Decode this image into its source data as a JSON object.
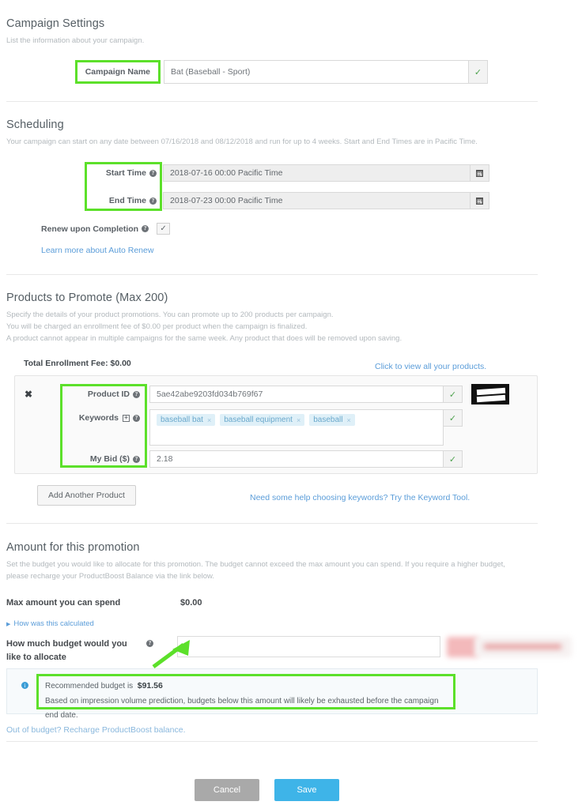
{
  "campaign_settings": {
    "title": "Campaign Settings",
    "subtitle": "List the information about your campaign.",
    "name_label": "Campaign Name",
    "name_value": "Bat (Baseball - Sport)",
    "valid_icon": "check-icon"
  },
  "scheduling": {
    "title": "Scheduling",
    "subtitle": "Your campaign can start on any date between 07/16/2018 and 08/12/2018 and run for up to 4 weeks. Start and End Times are in Pacific Time.",
    "start_label": "Start Time",
    "start_value": "2018-07-16 00:00 Pacific Time",
    "end_label": "End Time",
    "end_value": "2018-07-23 00:00 Pacific Time",
    "renew_label": "Renew upon Completion",
    "renew_checked": "✓",
    "auto_renew_link": "Learn more about Auto Renew",
    "calendar_icon": "calendar-icon"
  },
  "products": {
    "title": "Products to Promote (Max 200)",
    "subtitle_line1": "Specify the details of your product promotions. You can promote up to 200 products per campaign.",
    "subtitle_line2": "You will be charged an enrollment fee of $0.00 per product when the campaign is finalized.",
    "subtitle_line3": "A product cannot appear in multiple campaigns for the same week. Any product that does will be removed upon saving.",
    "total_fee_label": "Total Enrollment Fee: $0.00",
    "view_all_link": "Click to view all your products.",
    "remove_icon": "close-icon",
    "product_id_label": "Product ID",
    "product_id_value": "5ae42abe9203fd034b769f67",
    "keywords_label": "Keywords",
    "keywords": [
      {
        "text": "baseball bat",
        "remove": "×"
      },
      {
        "text": "baseball equipment",
        "remove": "×"
      },
      {
        "text": "baseball",
        "remove": "×"
      }
    ],
    "bid_label": "My Bid ($)",
    "bid_value": "2.18",
    "add_product_button": "Add Another Product",
    "keyword_tool_link": "Need some help choosing keywords? Try the Keyword Tool."
  },
  "amount": {
    "title": "Amount for this promotion",
    "subtitle_line1": "Set the budget you would like to allocate for this promotion. The budget cannot exceed the max amount you can spend. If you require a higher budget,",
    "subtitle_line2": "please recharge your ProductBoost Balance via the link below.",
    "max_spend_label": "Max amount you can spend",
    "max_spend_value": "$0.00",
    "how_calculated_link": "How was this calculated",
    "budget_label_line1": "How much budget would you",
    "budget_label_line2": "like to allocate",
    "budget_value": "",
    "recommended_prefix": "Recommended budget is",
    "recommended_value": "$91.56",
    "recommended_note": "Based on impression volume prediction, budgets below this amount will likely be exhausted before the campaign end date.",
    "recharge_link": "Out of budget? Recharge ProductBoost balance."
  },
  "footer": {
    "cancel_label": "Cancel",
    "save_label": "Save"
  },
  "colors": {
    "annotation_green": "#5ce02a",
    "link_blue": "#5b9dd9",
    "save_blue": "#3eb4e8",
    "cancel_gray": "#a9a9a9",
    "tag_bg": "#dff0f8"
  }
}
